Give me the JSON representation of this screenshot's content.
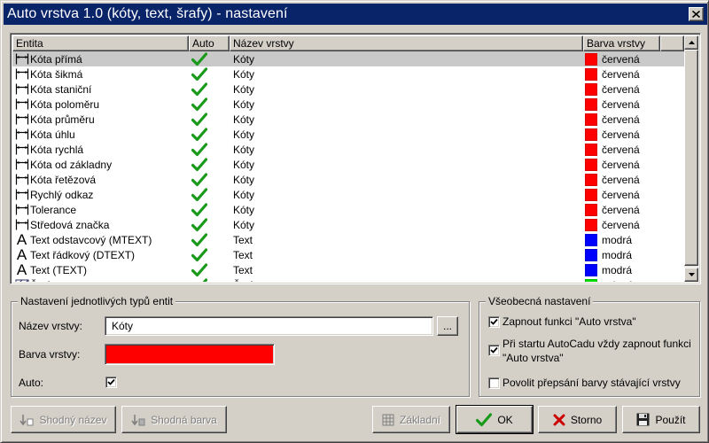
{
  "window": {
    "title": "Auto vrstva 1.0 (kóty, text, šrafy) - nastavení"
  },
  "list": {
    "columns": {
      "entity": "Entita",
      "auto": "Auto",
      "layer": "Název vrstvy",
      "color": "Barva vrstvy"
    },
    "rows": [
      {
        "icon": "dimension-icon",
        "entity": "Kóta přímá",
        "layer": "Kóty",
        "color_name": "červená",
        "color": "#ff0000"
      },
      {
        "icon": "dimension-icon",
        "entity": "Kóta šikmá",
        "layer": "Kóty",
        "color_name": "červená",
        "color": "#ff0000"
      },
      {
        "icon": "dimension-icon",
        "entity": "Kóta staniční",
        "layer": "Kóty",
        "color_name": "červená",
        "color": "#ff0000"
      },
      {
        "icon": "dimension-icon",
        "entity": "Kóta poloměru",
        "layer": "Kóty",
        "color_name": "červená",
        "color": "#ff0000"
      },
      {
        "icon": "dimension-icon",
        "entity": "Kóta průměru",
        "layer": "Kóty",
        "color_name": "červená",
        "color": "#ff0000"
      },
      {
        "icon": "dimension-icon",
        "entity": "Kóta úhlu",
        "layer": "Kóty",
        "color_name": "červená",
        "color": "#ff0000"
      },
      {
        "icon": "dimension-icon",
        "entity": "Kóta rychlá",
        "layer": "Kóty",
        "color_name": "červená",
        "color": "#ff0000"
      },
      {
        "icon": "dimension-icon",
        "entity": "Kóta od základny",
        "layer": "Kóty",
        "color_name": "červená",
        "color": "#ff0000"
      },
      {
        "icon": "dimension-icon",
        "entity": "Kóta řetězová",
        "layer": "Kóty",
        "color_name": "červená",
        "color": "#ff0000"
      },
      {
        "icon": "dimension-icon",
        "entity": "Rychlý odkaz",
        "layer": "Kóty",
        "color_name": "červená",
        "color": "#ff0000"
      },
      {
        "icon": "dimension-icon",
        "entity": "Tolerance",
        "layer": "Kóty",
        "color_name": "červená",
        "color": "#ff0000"
      },
      {
        "icon": "dimension-icon",
        "entity": "Středová značka",
        "layer": "Kóty",
        "color_name": "červená",
        "color": "#ff0000"
      },
      {
        "icon": "text-icon",
        "entity": "Text odstavcový (MTEXT)",
        "layer": "Text",
        "color_name": "modrá",
        "color": "#0000ff"
      },
      {
        "icon": "text-icon",
        "entity": "Text řádkový (DTEXT)",
        "layer": "Text",
        "color_name": "modrá",
        "color": "#0000ff"
      },
      {
        "icon": "text-icon",
        "entity": "Text (TEXT)",
        "layer": "Text",
        "color_name": "modrá",
        "color": "#0000ff"
      },
      {
        "icon": "hatch-icon",
        "entity": "Šrafy",
        "layer": "Šrafy",
        "color_name": "zelená",
        "color": "#00dd00"
      }
    ],
    "selected_row": 0
  },
  "entity_settings": {
    "legend": "Nastavení jednotlivých typů entit",
    "layer_name_label": "Název vrstvy:",
    "layer_name_value": "Kóty",
    "browse_label": "...",
    "layer_color_label": "Barva vrstvy:",
    "layer_color": "#ff0000",
    "auto_label": "Auto:",
    "auto_checked": true
  },
  "general_settings": {
    "legend": "Všeobecná nastavení",
    "option1": "Zapnout funkci \"Auto vrstva\"",
    "option1_checked": true,
    "option2": "Při startu AutoCadu vždy zapnout funkci \"Auto vrstva\"",
    "option2_checked": true,
    "option3": "Povolit přepsání barvy stávající vrstvy",
    "option3_checked": false
  },
  "buttons": {
    "same_name": "Shodný název",
    "same_color": "Shodná barva",
    "default": "Základní",
    "ok": "OK",
    "cancel": "Storno",
    "apply": "Použít"
  },
  "colors": {
    "title_bar": "#0a246a",
    "face": "#d4d0c8",
    "check_green": "#1a9a1a"
  }
}
